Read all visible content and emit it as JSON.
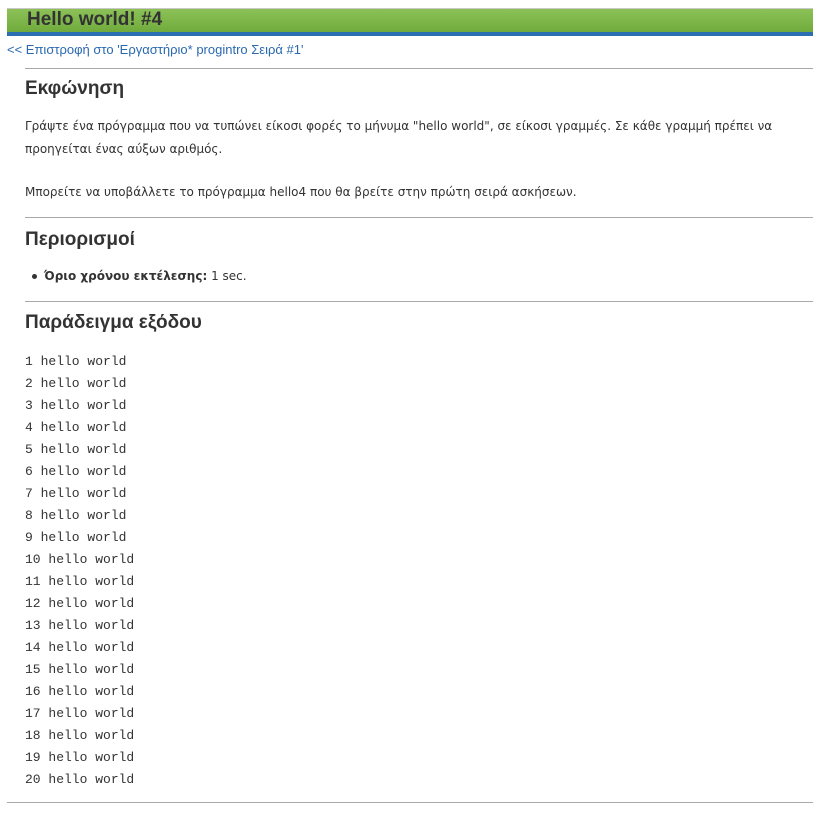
{
  "header": {
    "title": "Hello world! #4",
    "back_link": "<< Επιστροφή στο 'Εργαστήριο* progintro Σειρά #1'"
  },
  "statement": {
    "heading": "Εκφώνηση",
    "line1": "Γράψτε ένα πρόγραμμα που να τυπώνει είκοσι φορές το μήνυμα \"hello world\", σε είκοσι γραμμές. Σε κάθε γραμμή πρέπει να",
    "line2": "προηγείται ένας αύξων αριθμός.",
    "line3": "Μπορείτε να υποβάλλετε το πρόγραμμα hello4 που θα βρείτε στην πρώτη σειρά ασκήσεων."
  },
  "constraints": {
    "heading": "Περιορισμοί",
    "items": [
      {
        "label": "Όριο χρόνου εκτέλεσης:",
        "value": " 1 sec."
      }
    ]
  },
  "sample_output": {
    "heading": "Παράδειγμα εξόδου",
    "lines": [
      "1 hello world",
      "2 hello world",
      "3 hello world",
      "4 hello world",
      "5 hello world",
      "6 hello world",
      "7 hello world",
      "8 hello world",
      "9 hello world",
      "10 hello world",
      "11 hello world",
      "12 hello world",
      "13 hello world",
      "14 hello world",
      "15 hello world",
      "16 hello world",
      "17 hello world",
      "18 hello world",
      "19 hello world",
      "20 hello world"
    ]
  },
  "colors": {
    "title_bar_green": "#7ab648",
    "title_underline_blue": "#2b6fb2",
    "link_blue": "#2a69b0",
    "rule_gray": "#a8a8a8",
    "text": "#333333"
  }
}
